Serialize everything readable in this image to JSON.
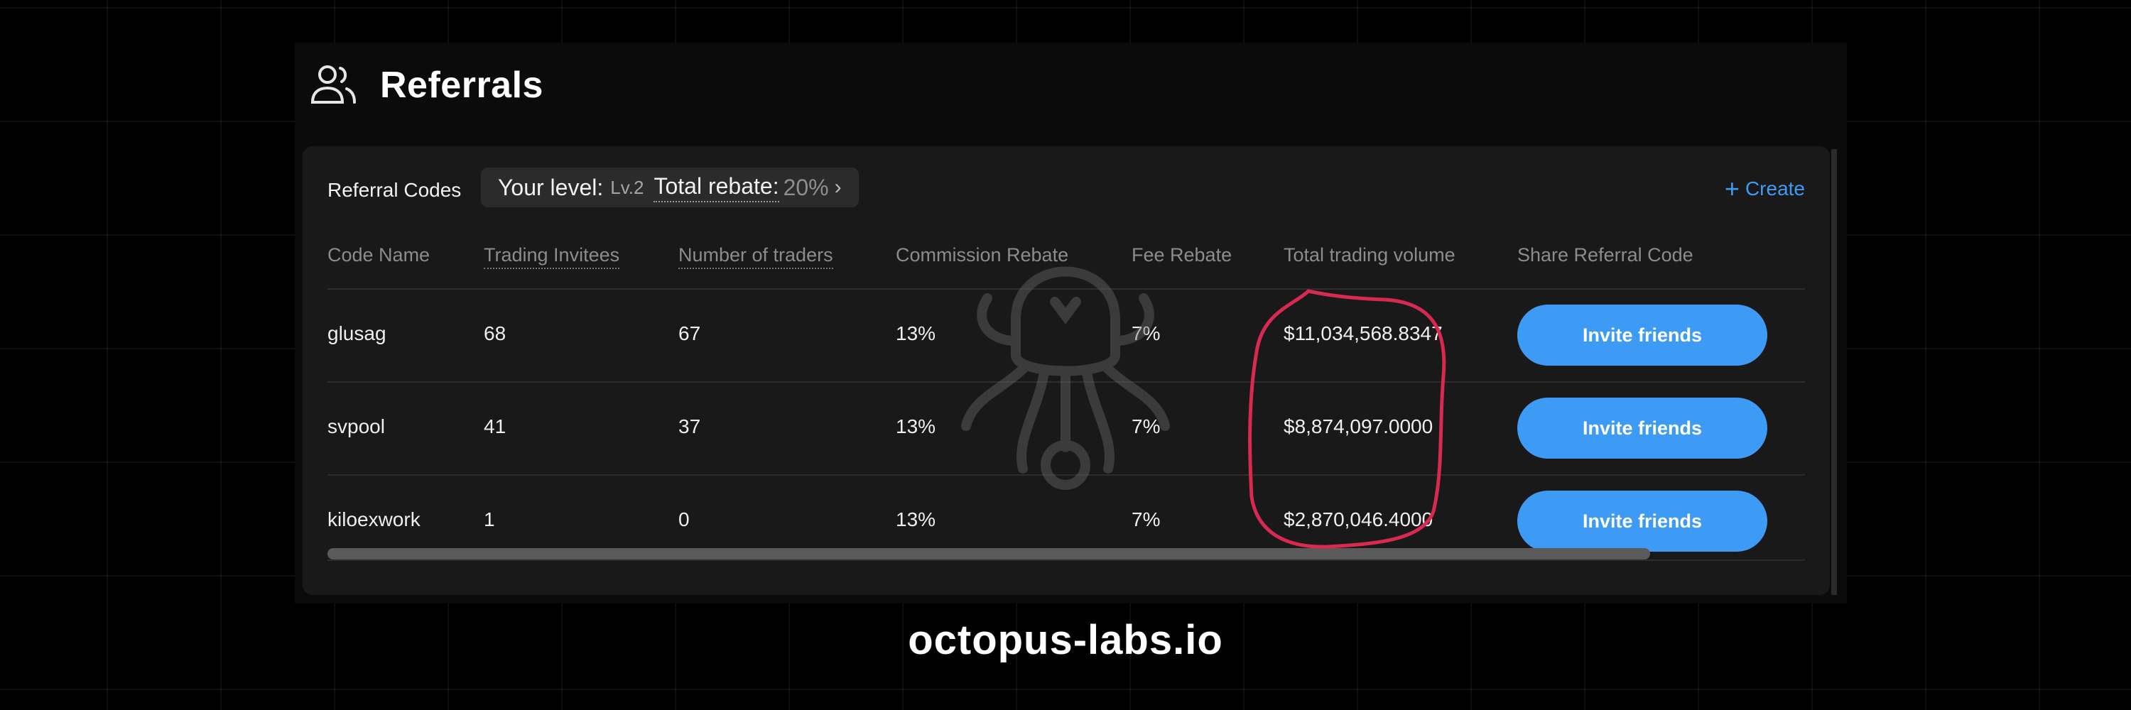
{
  "header": {
    "title": "Referrals",
    "icon": "users-icon"
  },
  "toolbar": {
    "codes_label": "Referral Codes",
    "level_label": "Your level:",
    "level_value": "Lv.2",
    "rebate_label": "Total rebate:",
    "rebate_value": "20%",
    "create_label": "Create"
  },
  "table": {
    "columns": [
      "Code Name",
      "Trading Invitees",
      "Number of traders",
      "Commission Rebate",
      "Fee Rebate",
      "Total trading volume",
      "Share Referral Code"
    ],
    "rows": [
      {
        "code": "glusag",
        "invitees": "68",
        "traders": "67",
        "commission": "13%",
        "fee": "7%",
        "volume": "$11,034,568.8347",
        "action": "Invite friends"
      },
      {
        "code": "svpool",
        "invitees": "41",
        "traders": "37",
        "commission": "13%",
        "fee": "7%",
        "volume": "$8,874,097.0000",
        "action": "Invite friends"
      },
      {
        "code": "kiloexwork",
        "invitees": "1",
        "traders": "0",
        "commission": "13%",
        "fee": "7%",
        "volume": "$2,870,046.4000",
        "action": "Invite friends"
      }
    ]
  },
  "footer": {
    "brand": "octopus-labs.io"
  },
  "colors": {
    "accent": "#3d9bf5",
    "highlight": "#d8294f",
    "card": "#191919",
    "background": "#000000"
  }
}
